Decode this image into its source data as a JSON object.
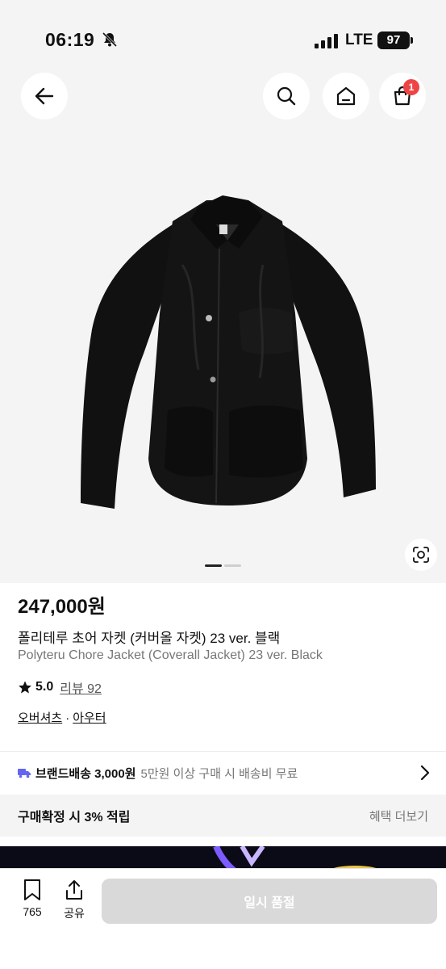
{
  "status_bar": {
    "time": "06:19",
    "network": "LTE",
    "battery": "97"
  },
  "header": {
    "cart_count": "1"
  },
  "gallery": {
    "current_slide": 1,
    "total_slides": 2
  },
  "product": {
    "price": "247,000원",
    "title_ko": "폴리테루 초어 자켓 (커버올 자켓) 23 ver. 블랙",
    "title_en": "Polyteru Chore Jacket (Coverall Jacket) 23 ver. Black",
    "rating": "5.0",
    "review_label": "리뷰 92",
    "categories": [
      "오버셔츠",
      "아우터"
    ],
    "category_separator": "·"
  },
  "shipping": {
    "label": "브랜드배송 3,000원",
    "condition": "5만원 이상 구매 시 배송비 무료"
  },
  "reward": {
    "text": "구매확정 시 3% 적립",
    "more": "혜택 더보기"
  },
  "bottom_bar": {
    "like_count": "765",
    "share_label": "공유",
    "action_label": "일시 품절"
  },
  "colors": {
    "badge": "#ef4444",
    "shipping_icon": "#6366f1",
    "disabled_button": "#d9d9d9"
  }
}
